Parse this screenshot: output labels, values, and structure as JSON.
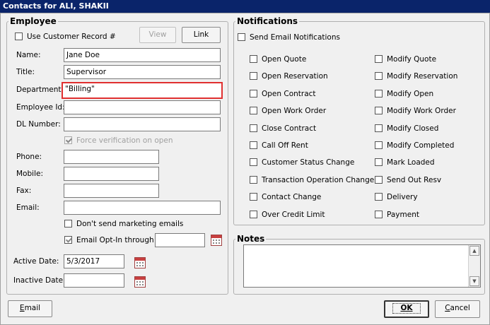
{
  "window": {
    "title": "Contacts for ALI, SHAKII"
  },
  "employee": {
    "legend": "Employee",
    "use_customer_record": {
      "label": "Use Customer Record #",
      "checked": false
    },
    "view_label": "View",
    "link_label": "Link",
    "name": {
      "label": "Name:",
      "value": "Jane Doe"
    },
    "title": {
      "label": "Title:",
      "value": "Supervisor"
    },
    "department": {
      "label": "Department:",
      "value": "\"Billing\""
    },
    "employee_id": {
      "label": "Employee Id:",
      "value": ""
    },
    "dl_number": {
      "label": "DL Number:",
      "value": ""
    },
    "force_verification": {
      "label": "Force verification on open",
      "checked": true
    },
    "phone": {
      "label": "Phone:",
      "value": ""
    },
    "mobile": {
      "label": "Mobile:",
      "value": ""
    },
    "fax": {
      "label": "Fax:",
      "value": ""
    },
    "email": {
      "label": "Email:",
      "value": ""
    },
    "dont_send_marketing": {
      "label": "Don't send marketing emails",
      "checked": false
    },
    "email_opt_in": {
      "label": "Email Opt-In through",
      "checked": true,
      "value": ""
    },
    "active_date": {
      "label": "Active Date:",
      "value": "5/3/2017"
    },
    "inactive_date": {
      "label": "Inactive Date:",
      "value": ""
    }
  },
  "notifications": {
    "legend": "Notifications",
    "send_email": {
      "label": "Send Email Notifications",
      "checked": false
    },
    "left": [
      "Open Quote",
      "Open Reservation",
      "Open Contract",
      "Open Work Order",
      "Close Contract",
      "Call Off Rent",
      "Customer Status Change",
      "Transaction Operation Change",
      "Contact Change",
      "Over Credit Limit"
    ],
    "right": [
      "Modify Quote",
      "Modify Reservation",
      "Modify Open",
      "Modify Work Order",
      "Modify Closed",
      "Modify Completed",
      "Mark Loaded",
      "Send Out Resv",
      "Delivery",
      "Payment"
    ]
  },
  "notes": {
    "legend": "Notes",
    "value": ""
  },
  "footer": {
    "email_label_u": "E",
    "email_label_rest": "mail",
    "ok_label": "OK",
    "cancel_label_u": "C",
    "cancel_label_rest": "ancel"
  }
}
